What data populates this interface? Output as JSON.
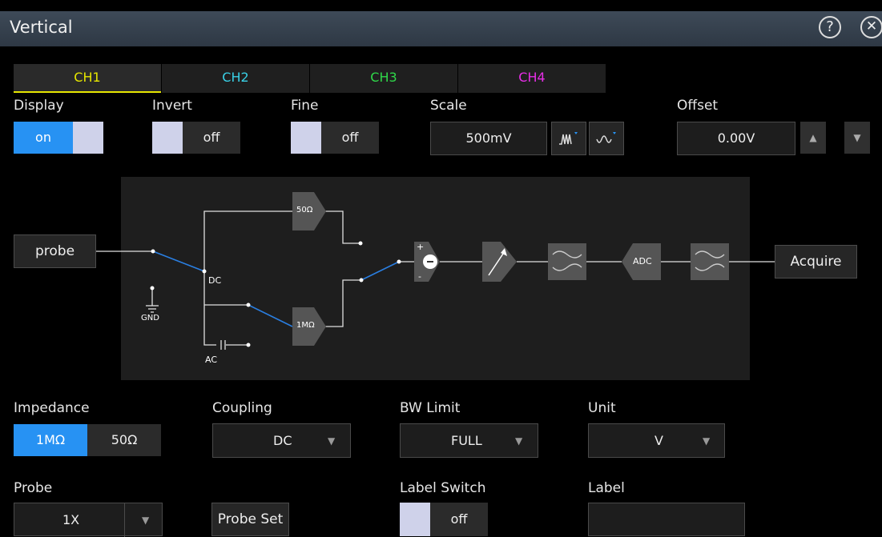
{
  "window": {
    "title": "Vertical"
  },
  "tabs": [
    {
      "label": "CH1",
      "color": "#e6e600"
    },
    {
      "label": "CH2",
      "color": "#39d0e6"
    },
    {
      "label": "CH3",
      "color": "#2fd84a"
    },
    {
      "label": "CH4",
      "color": "#e62ee6"
    }
  ],
  "display": {
    "label": "Display",
    "value": "on"
  },
  "invert": {
    "label": "Invert",
    "value": "off"
  },
  "fine": {
    "label": "Fine",
    "value": "off"
  },
  "scale": {
    "label": "Scale",
    "value": "500mV"
  },
  "offset": {
    "label": "Offset",
    "value": "0.00V"
  },
  "diagram": {
    "probe": "probe",
    "acquire": "Acquire",
    "r50": "50Ω",
    "r1m": "1MΩ",
    "dc": "DC",
    "ac": "AC",
    "gnd": "GND",
    "adc": "ADC",
    "plus": "+",
    "minus": "-"
  },
  "impedance": {
    "label": "Impedance",
    "options": [
      "1MΩ",
      "50Ω"
    ],
    "selected": "1MΩ"
  },
  "coupling": {
    "label": "Coupling",
    "value": "DC"
  },
  "bwlimit": {
    "label": "BW Limit",
    "value": "FULL"
  },
  "unit": {
    "label": "Unit",
    "value": "V"
  },
  "probe": {
    "label": "Probe",
    "value": "1X",
    "set_label": "Probe Set"
  },
  "label_switch": {
    "label": "Label Switch",
    "value": "off"
  },
  "label_field": {
    "label": "Label",
    "value": ""
  },
  "colors": {
    "accent": "#1e8fff",
    "on_fill": "#2792f3"
  }
}
